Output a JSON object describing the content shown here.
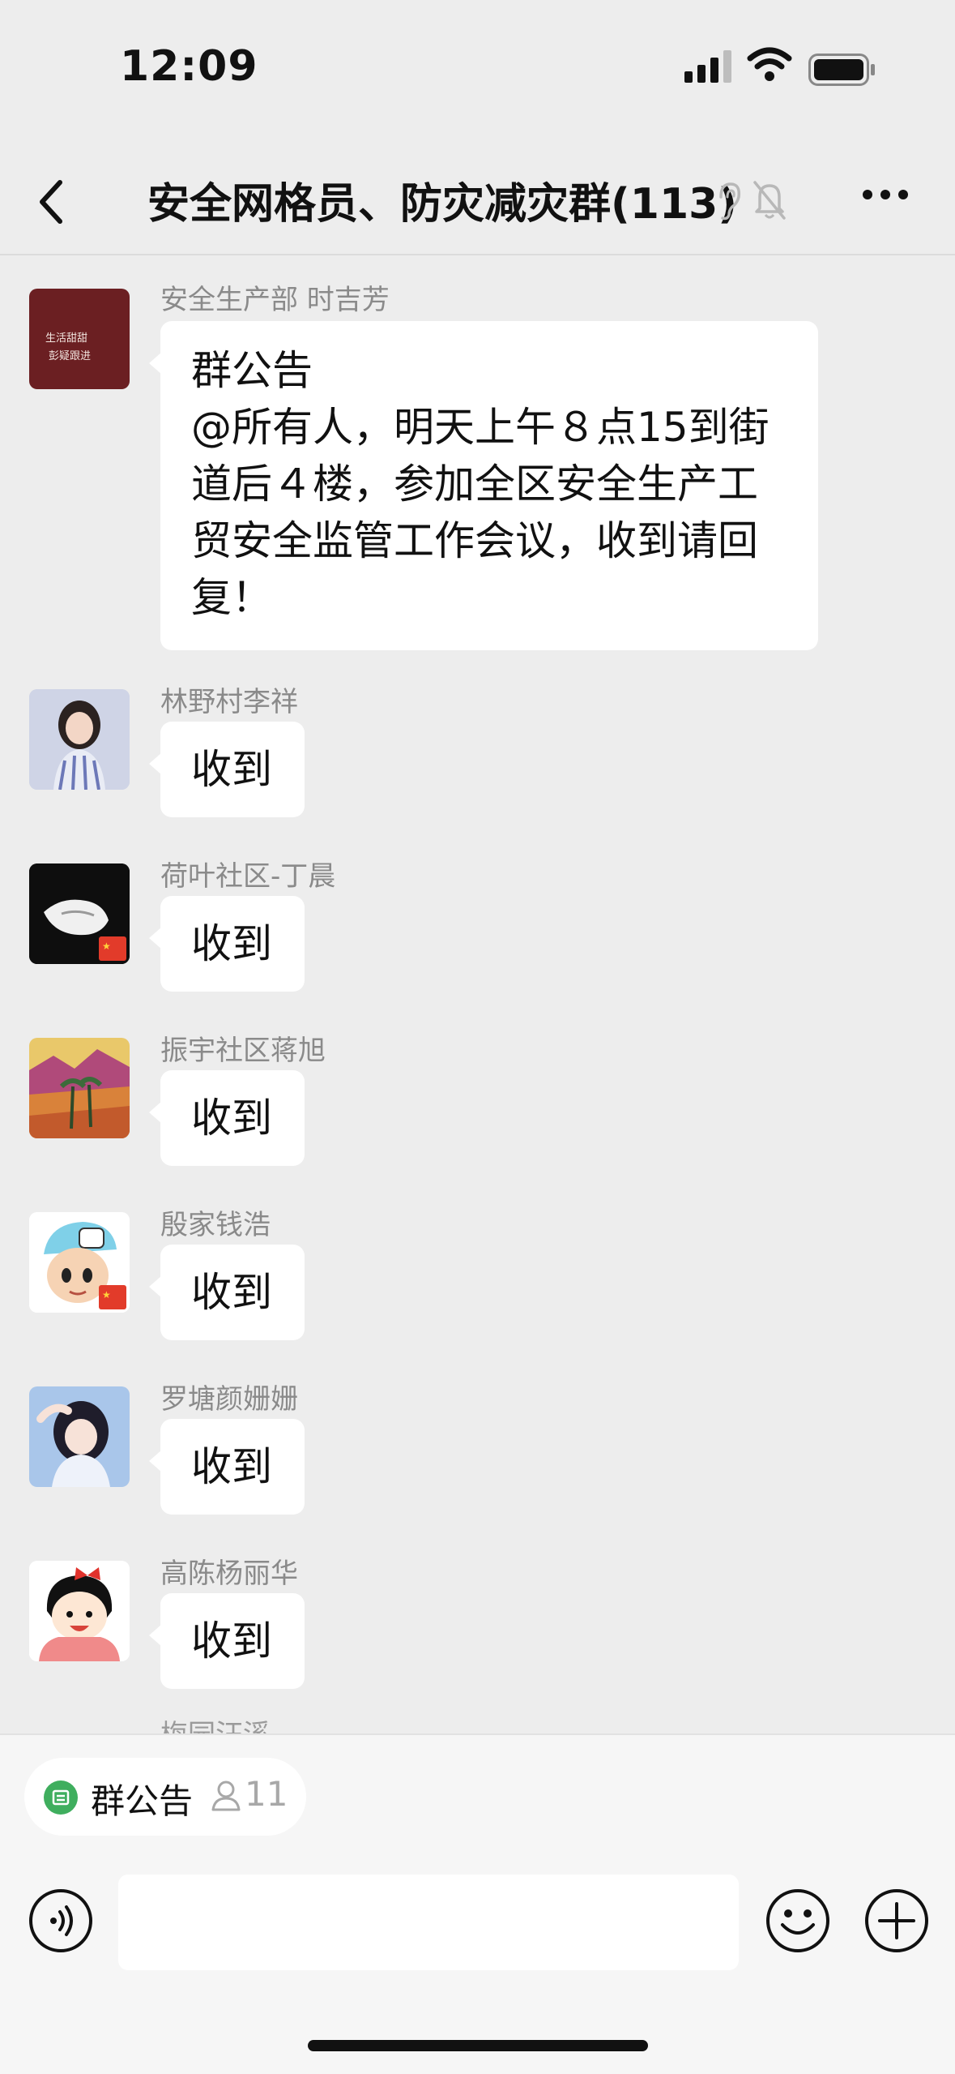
{
  "status_bar": {
    "time": "12:09"
  },
  "nav": {
    "title": "安全网格员、防灾减灾群(113)"
  },
  "messages": [
    {
      "sender": "安全生产部 时吉芳",
      "text": "群公告\n@所有人，明天上午８点15到街道后４楼，参加全区安全生产工贸安全监管工作会议，收到请回复！",
      "avatar_text_1": "生活甜甜",
      "avatar_text_2": "彭疑跟进"
    },
    {
      "sender": "林野村李祥",
      "text": "收到"
    },
    {
      "sender": "荷叶社区-丁晨",
      "text": "收到"
    },
    {
      "sender": "振宇社区蒋旭",
      "text": "收到"
    },
    {
      "sender": "殷家钱浩",
      "text": "收到"
    },
    {
      "sender": "罗塘颜姗姗",
      "text": "收到"
    },
    {
      "sender": "高陈杨丽华",
      "text": "收到"
    }
  ],
  "partial_sender": "梅园汪溪",
  "announcement_chip": {
    "label": "群公告",
    "count": "11"
  },
  "colors": {
    "background": "#ededed",
    "bubble": "#ffffff",
    "accent_green": "#3fae5e"
  },
  "icons": [
    "back-icon",
    "ear-icon",
    "mute-bell-icon",
    "more-icon",
    "voice-icon",
    "emoji-icon",
    "plus-icon",
    "user-icon"
  ]
}
